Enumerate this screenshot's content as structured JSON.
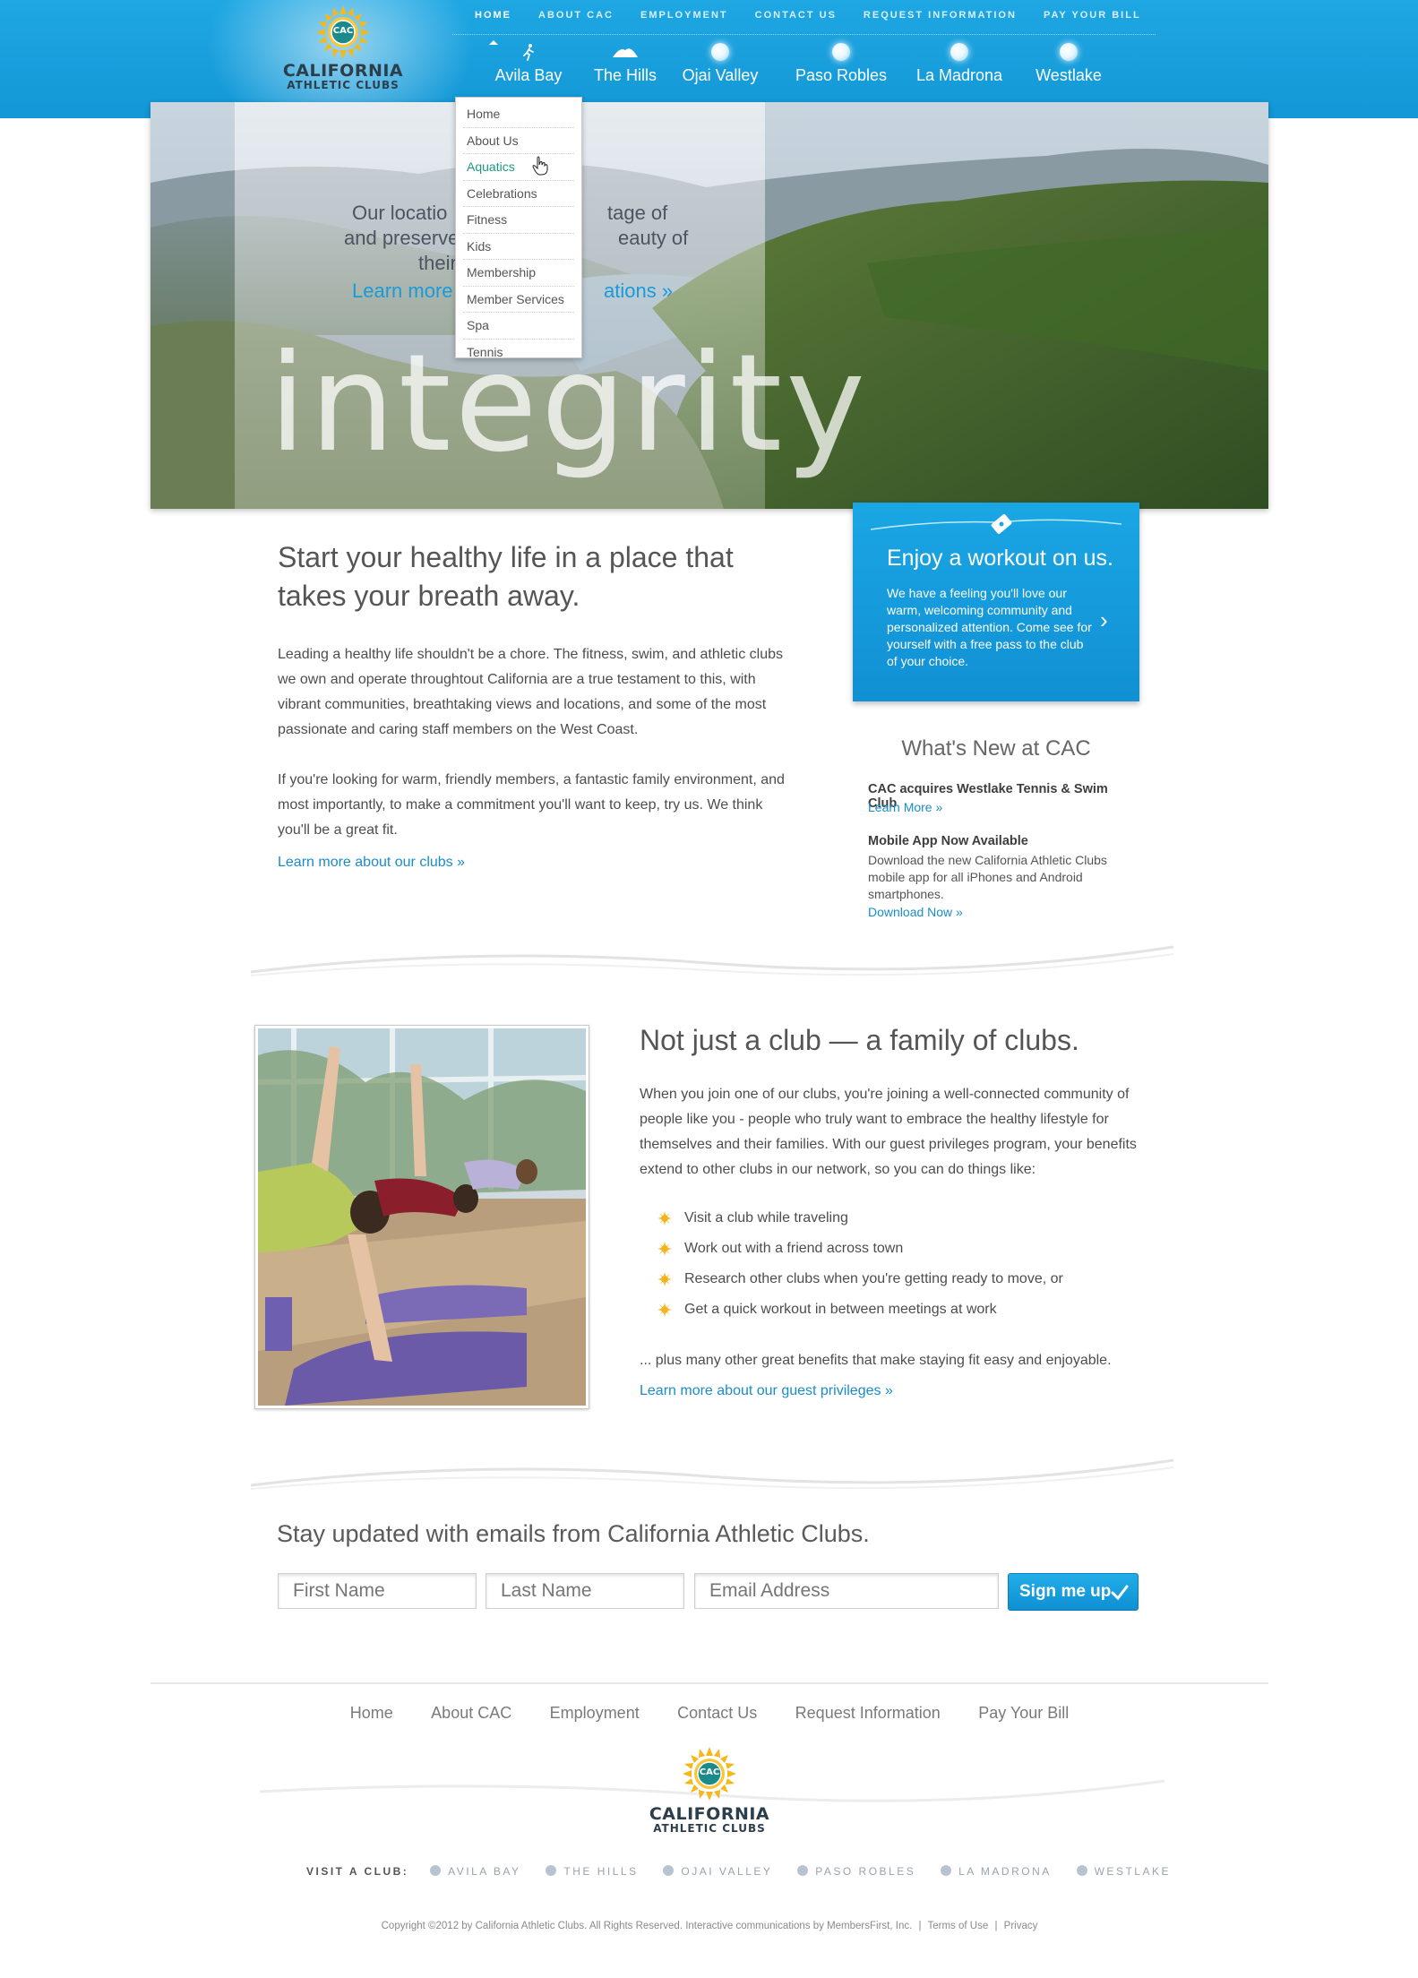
{
  "brand": {
    "logo_line1": "CALIFORNIA",
    "logo_line2": "ATHLETIC CLUBS",
    "logo_badge": "CAC",
    "primary_color": "#1ea7e3",
    "accent_color": "#1a8cc9"
  },
  "utility_nav": [
    "HOME",
    "ABOUT CAC",
    "EMPLOYMENT",
    "CONTACT US",
    "REQUEST INFORMATION",
    "PAY YOUR BILL"
  ],
  "club_nav": [
    {
      "label": "Avila Bay",
      "icon": "runner-icon"
    },
    {
      "label": "The Hills",
      "icon": "hills-icon"
    },
    {
      "label": "Ojai Valley",
      "icon": "orb-icon"
    },
    {
      "label": "Paso Robles",
      "icon": "orb-icon"
    },
    {
      "label": "La Madrona",
      "icon": "orb-icon"
    },
    {
      "label": "Westlake",
      "icon": "orb-icon"
    }
  ],
  "dropdown": {
    "items": [
      "Home",
      "About Us",
      "Aquatics",
      "Celebrations",
      "Fitness",
      "Kids",
      "Membership",
      "Member Services",
      "Spa",
      "Tennis"
    ],
    "active": "Aquatics"
  },
  "hero": {
    "line1_left": "Our locatio",
    "line1_right": "tage of",
    "line2_left": "and preserve",
    "line2_right": "eauty of",
    "line3_left": "their",
    "link_left": "Learn more",
    "link_right": "ations »",
    "big_word": "integrity"
  },
  "callout": {
    "title": "Enjoy a workout on us.",
    "text": "We have a feeling you'll love our warm, welcoming community and personalized attention. Come see for yourself with a free pass to the club of your choice.",
    "arrow": "›"
  },
  "intro": {
    "heading_line1": "Start your healthy life in a place that",
    "heading_line2": "takes your breath away.",
    "para1": "Leading a healthy life shouldn't be a chore. The fitness, swim, and athletic clubs we own and operate throughtout California are a true testament to this, with vibrant communities, breathtaking views and locations, and some of the most passionate and caring staff members on the West Coast.",
    "para2": "If you're looking for warm, friendly members, a fantastic family environment, and most importantly, to make a commitment you'll want to keep, try us. We think you'll be a great fit.",
    "link": "Learn more about our clubs »"
  },
  "whats_new": {
    "title": "What's New at CAC",
    "items": [
      {
        "headline": "CAC acquires Westlake Tennis & Swim Club",
        "text": "",
        "link": "Learn More »"
      },
      {
        "headline": "Mobile App Now Available",
        "text": "Download the new California Athletic Clubs mobile app for all iPhones and Android smartphones.",
        "link": "Download Now »"
      }
    ]
  },
  "family": {
    "heading": "Not just a club — a family of clubs.",
    "para": "When you join one of our clubs, you're joining a well-connected community of people like you - people who truly want to embrace the healthy lifestyle for themselves and their families. With our guest privileges program, your benefits extend to other clubs in our network, so you can do things like:",
    "bullets": [
      "Visit a club while traveling",
      "Work out with a friend across town",
      "Research other clubs when you're getting ready to move, or",
      "Get a quick workout in between meetings at work"
    ],
    "closing": "... plus many other great benefits that make staying fit easy and enjoyable.",
    "link": "Learn more about our guest privileges »"
  },
  "signup": {
    "heading": "Stay updated with emails from California Athletic Clubs.",
    "first_name_placeholder": "First Name",
    "last_name_placeholder": "Last Name",
    "email_placeholder": "Email Address",
    "button_label": "Sign me up",
    "button_icon": "check-icon"
  },
  "footer": {
    "nav": [
      "Home",
      "About CAC",
      "Employment",
      "Contact Us",
      "Request Information",
      "Pay Your Bill"
    ],
    "visit_label": "VISIT A CLUB:",
    "clubs": [
      "AVILA BAY",
      "THE HILLS",
      "OJAI VALLEY",
      "PASO ROBLES",
      "LA MADRONA",
      "WESTLAKE"
    ],
    "copyright": "Copyright ©2012 by California Athletic Clubs. All Rights Reserved. Interactive communications by MembersFirst, Inc.",
    "sep": "|",
    "terms": "Terms of Use",
    "privacy": "Privacy"
  }
}
